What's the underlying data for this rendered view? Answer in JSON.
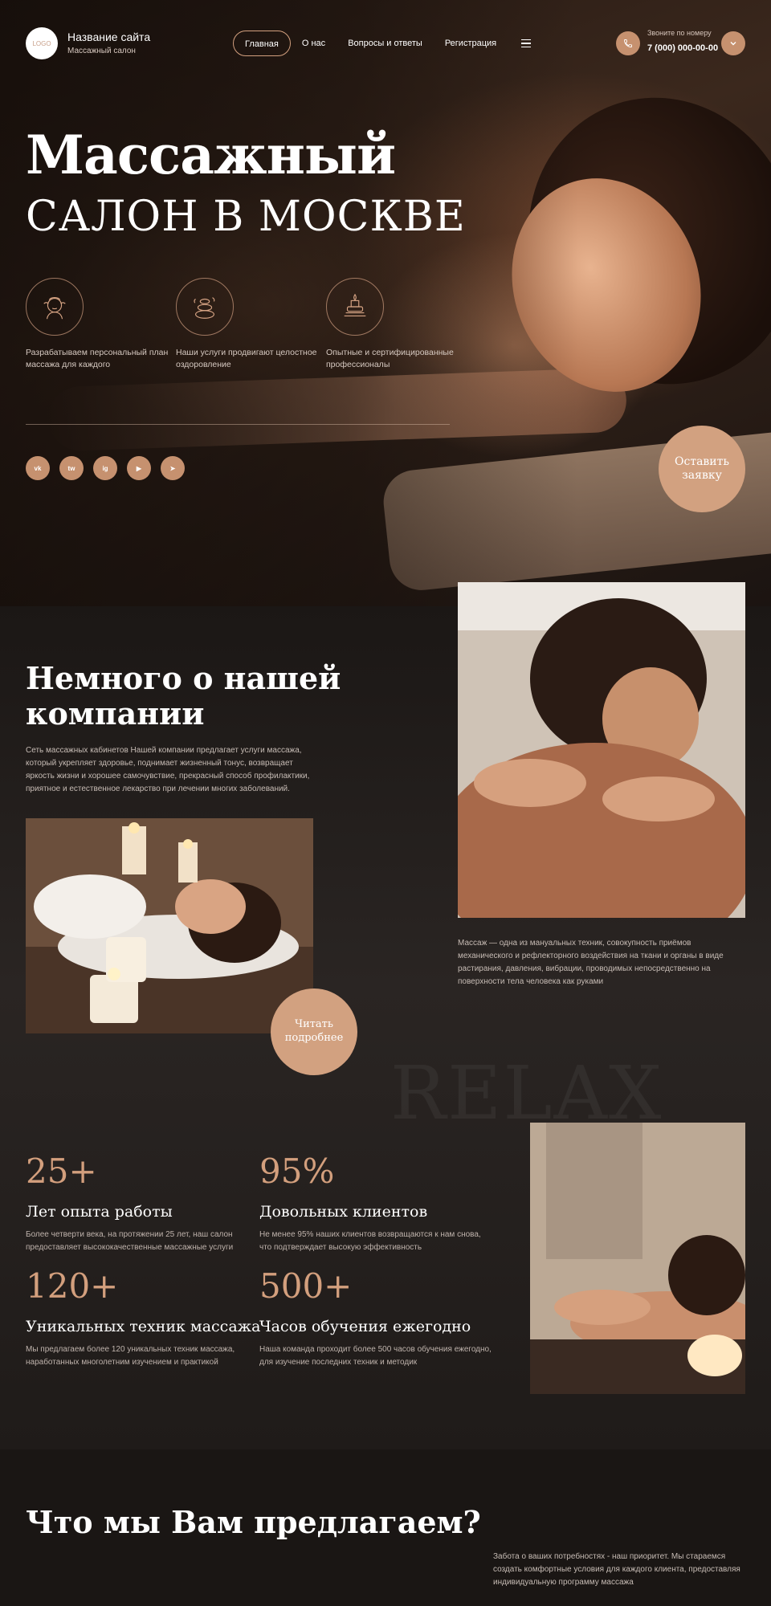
{
  "header": {
    "logo_text": "LOGO",
    "site_name": "Название сайта",
    "site_subtitle": "Массажный салон",
    "nav": [
      {
        "label": "Главная",
        "active": true
      },
      {
        "label": "О нас",
        "active": false
      },
      {
        "label": "Вопросы и ответы",
        "active": false
      },
      {
        "label": "Регистрация",
        "active": false
      }
    ],
    "phone_label": "Звоните по номеру",
    "phone_number": "7 (000) 000-00-00"
  },
  "hero": {
    "title_line1": "Массажный",
    "title_line2": "САЛОН В МОСКВЕ",
    "features": [
      {
        "icon": "face-massage-icon",
        "text": "Разрабатываем персональный план массажа для каждого"
      },
      {
        "icon": "stones-icon",
        "text": "Наши услуги продвигают целостное оздоровление"
      },
      {
        "icon": "spa-candle-icon",
        "text": "Опытные и сертифицированные профессионалы"
      }
    ],
    "socials": [
      {
        "name": "vk-icon",
        "glyph": "vk"
      },
      {
        "name": "twitter-icon",
        "glyph": "tw"
      },
      {
        "name": "instagram-icon",
        "glyph": "ig"
      },
      {
        "name": "youtube-icon",
        "glyph": "▶"
      },
      {
        "name": "telegram-icon",
        "glyph": "➤"
      }
    ],
    "cta_label": "Оставить заявку"
  },
  "about": {
    "title": "Немного о нашей компании",
    "text": "Сеть массажных кабинетов Нашей компании предлагает услуги массажа, который укрепляет здоровье, поднимает жизненный тонус, возвращает яркость жизни и хорошее самочувствие, прекрасный способ профилактики, приятное и естественное лекарство при лечении многих заболеваний.",
    "read_more_label": "Читать подробнее",
    "massage_text": "Массаж — одна из мануальных техник, совокупность приёмов механического и рефлекторного воздействия на ткани и органы в виде растирания, давления, вибрации, проводимых непосредственно на поверхности тела человека как руками",
    "watermark": "RELAX",
    "stats": [
      {
        "value": "25+",
        "title": "Лет опыта работы",
        "desc": "Более четверти века, на протяжении 25 лет, наш салон предоставляет высококачественные массажные услуги"
      },
      {
        "value": "95%",
        "title": "Довольных клиентов",
        "desc": "Не менее 95% наших клиентов возвращаются к нам снова, что подтверждает высокую эффективность"
      },
      {
        "value": "120+",
        "title": "Уникальных техник массажа",
        "desc": "Мы предлагаем более 120 уникальных техник массажа, наработанных многолетним изучением и практикой"
      },
      {
        "value": "500+",
        "title": "Часов обучения ежегодно",
        "desc": "Наша команда проходит более 500 часов обучения ежегодно, для изучение последних техник и методик"
      }
    ]
  },
  "offer": {
    "title": "Что мы Вам предлагаем?",
    "text": "Забота о ваших потребностях - наш приоритет. Мы стараемся создать комфортные условия для каждого клиента, предоставляя индивидуальную программу массажа"
  },
  "colors": {
    "accent": "#d2a180",
    "background_dark": "#1a1614",
    "text_muted": "#c7bcb5"
  }
}
